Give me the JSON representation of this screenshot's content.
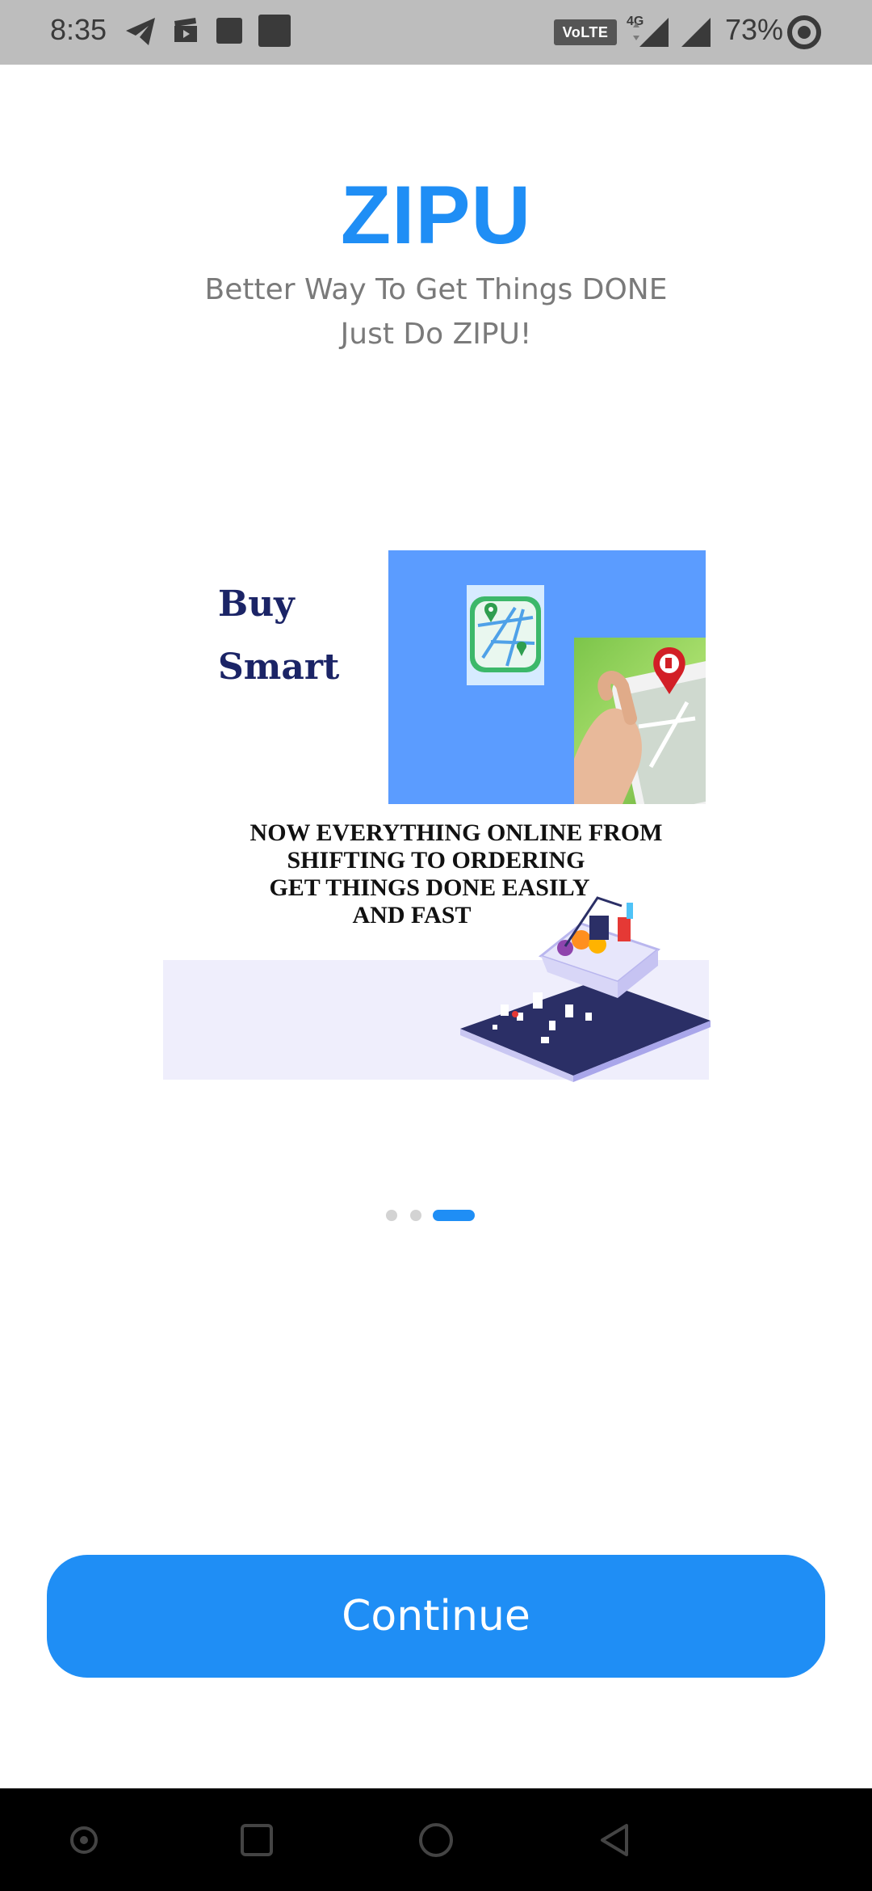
{
  "status_bar": {
    "time": "8:35",
    "network_badge": "VoLTE",
    "network_type": "4G",
    "battery_percent": "73%",
    "icons": [
      "telegram-icon",
      "clapperboard-icon",
      "square-icon",
      "square-icon",
      "signal-icon",
      "signal-icon",
      "battery-ring-icon"
    ]
  },
  "header": {
    "title": "ZIPU",
    "tagline_line1": "Better Way To Get Things DONE",
    "tagline_line2": "Just Do ZIPU!"
  },
  "slide": {
    "heading_line1": "Buy",
    "heading_line2": "Smart",
    "body_line1": "NOW EVERYTHING ONLINE FROM",
    "body_line2": "SHIFTING TO ORDERING",
    "body_line3": "GET THINGS DONE EASILY",
    "body_line4": "AND FAST"
  },
  "pager": {
    "count": 3,
    "active_index": 2
  },
  "actions": {
    "continue_label": "Continue"
  },
  "nav_bar": {
    "buttons": [
      "recent-apps-icon",
      "home-icon",
      "back-icon"
    ]
  },
  "colors": {
    "accent": "#1f8ef5",
    "status_bar_bg": "#bdbdbd",
    "heading_navy": "#1b2466"
  }
}
